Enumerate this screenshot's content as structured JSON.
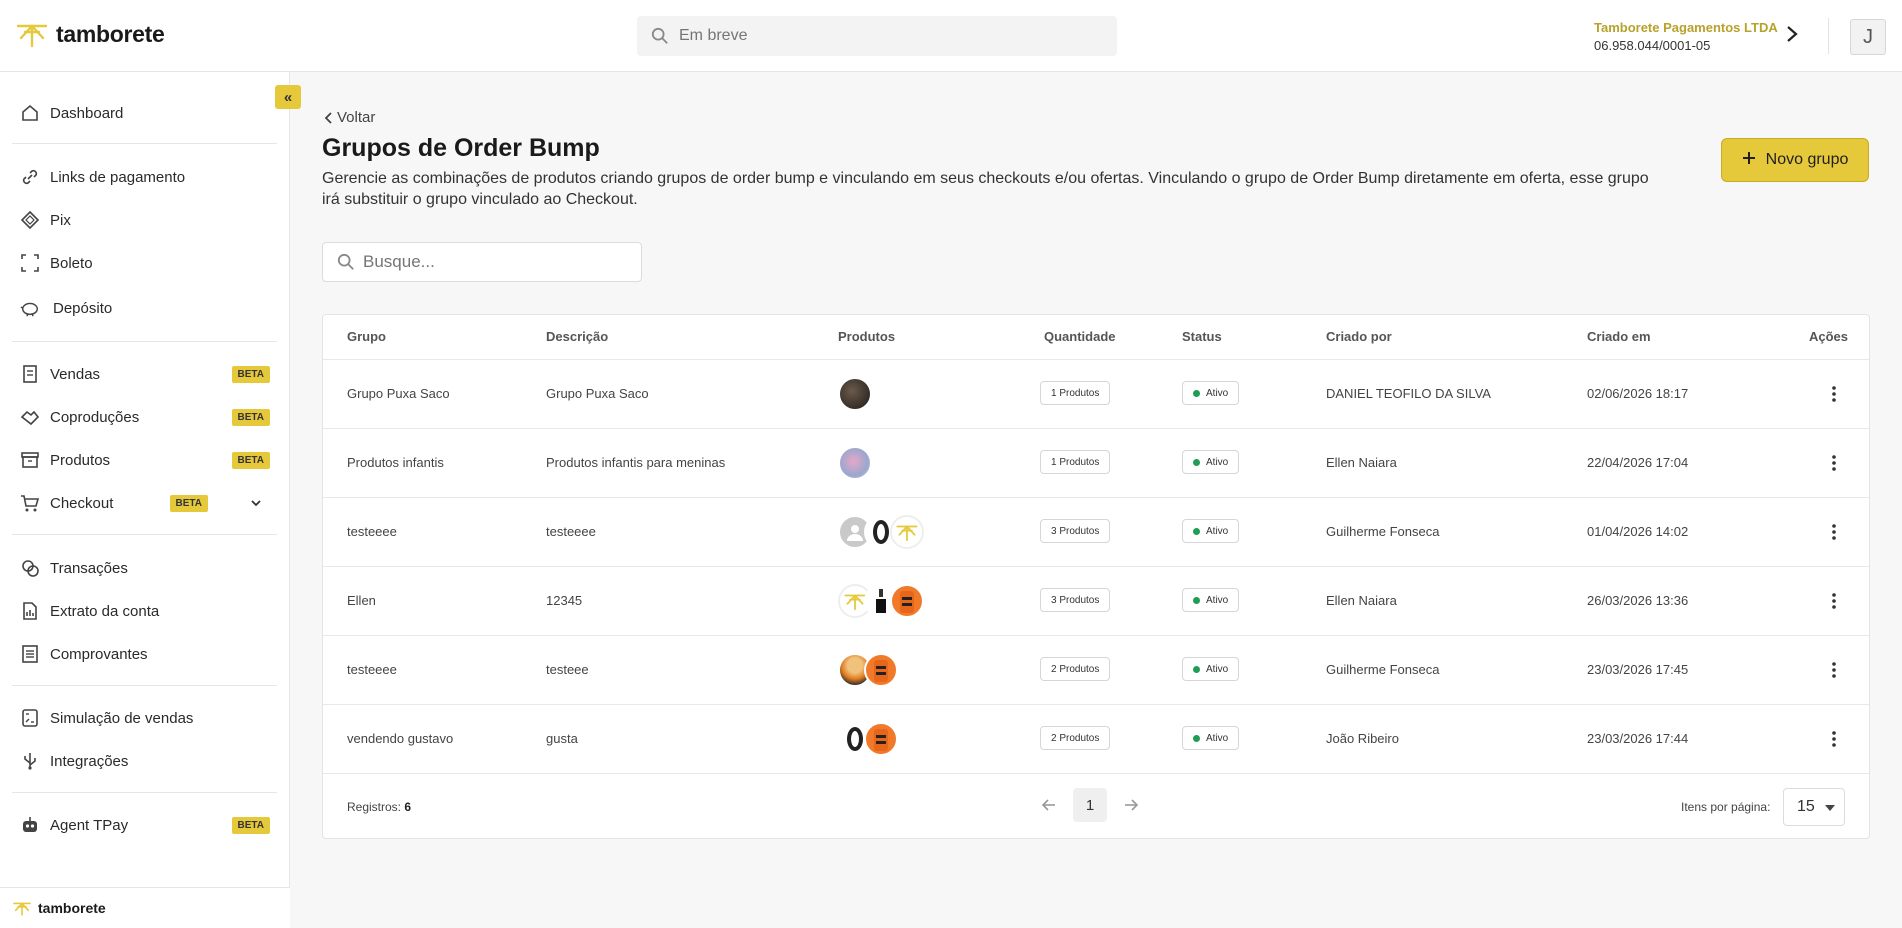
{
  "brand": {
    "name": "tamborete",
    "accent": "#e6c93a"
  },
  "search": {
    "placeholder": "Em breve"
  },
  "company": {
    "name": "Tamborete Pagamentos LTDA",
    "document": "06.958.044/0001-05"
  },
  "user": {
    "initial": "J"
  },
  "sidebar": {
    "collapse_label": "«",
    "items": [
      {
        "label": "Dashboard",
        "icon": "home-icon"
      },
      {
        "label": "Links de pagamento",
        "icon": "link-icon"
      },
      {
        "label": "Pix",
        "icon": "pix-icon"
      },
      {
        "label": "Boleto",
        "icon": "barcode-icon"
      },
      {
        "label": "Depósito",
        "icon": "piggy-bank-icon"
      },
      {
        "label": "Vendas",
        "icon": "receipt-icon",
        "badge": "BETA"
      },
      {
        "label": "Coproduções",
        "icon": "handshake-icon",
        "badge": "BETA"
      },
      {
        "label": "Produtos",
        "icon": "archive-icon",
        "badge": "BETA"
      },
      {
        "label": "Checkout",
        "icon": "cart-icon",
        "badge": "BETA"
      },
      {
        "label": "Transações",
        "icon": "coins-icon"
      },
      {
        "label": "Extrato da conta",
        "icon": "statement-icon"
      },
      {
        "label": "Comprovantes",
        "icon": "document-icon"
      },
      {
        "label": "Simulação de vendas",
        "icon": "calculator-icon"
      },
      {
        "label": "Integrações",
        "icon": "usb-icon"
      },
      {
        "label": "Agent TPay",
        "icon": "robot-icon",
        "badge": "BETA"
      }
    ],
    "footer_brand": "tamborete"
  },
  "page": {
    "back_label": "Voltar",
    "title": "Grupos de Order Bump",
    "description": "Gerencie as combinações de produtos criando grupos de order bump e vinculando em seus checkouts e/ou ofertas. Vinculando o grupo de Order Bump diretamente em oferta, esse grupo irá substituir o grupo vinculado ao Checkout.",
    "new_button": "Novo grupo",
    "search_placeholder": "Busque..."
  },
  "table": {
    "headers": [
      "Grupo",
      "Descrição",
      "Produtos",
      "Quantidade",
      "Status",
      "Criado por",
      "Criado em",
      "Ações"
    ],
    "rows": [
      {
        "grupo": "Grupo Puxa Saco",
        "descricao": "Grupo Puxa Saco",
        "produtos": [
          "photo-dark"
        ],
        "quantidade": "1 Produtos",
        "status": "Ativo",
        "criado_por": "DANIEL TEOFILO DA SILVA",
        "criado_em": "02/06/2026 18:17"
      },
      {
        "grupo": "Produtos infantis",
        "descricao": "Produtos infantis para meninas",
        "produtos": [
          "photo-pastel"
        ],
        "quantidade": "1 Produtos",
        "status": "Ativo",
        "criado_por": "Ellen Naiara",
        "criado_em": "22/04/2026 17:04"
      },
      {
        "grupo": "testeeee",
        "descricao": "testeeee",
        "produtos": [
          "placeholder-user",
          "tire",
          "logo"
        ],
        "quantidade": "3 Produtos",
        "status": "Ativo",
        "criado_por": "Guilherme Fonseca",
        "criado_em": "01/04/2026 14:02"
      },
      {
        "grupo": "Ellen",
        "descricao": "12345",
        "produtos": [
          "logo",
          "bottle",
          "orange-can"
        ],
        "quantidade": "3 Produtos",
        "status": "Ativo",
        "criado_por": "Ellen Naiara",
        "criado_em": "26/03/2026 13:36"
      },
      {
        "grupo": "testeeee",
        "descricao": "testeee",
        "produtos": [
          "anime-face",
          "orange-can"
        ],
        "quantidade": "2 Produtos",
        "status": "Ativo",
        "criado_por": "Guilherme Fonseca",
        "criado_em": "23/03/2026 17:45"
      },
      {
        "grupo": "vendendo gustavo",
        "descricao": "gusta",
        "produtos": [
          "tire",
          "orange-can"
        ],
        "quantidade": "2 Produtos",
        "status": "Ativo",
        "criado_por": "João Ribeiro",
        "criado_em": "23/03/2026 17:44"
      }
    ],
    "status_color": "#1f9d55"
  },
  "pagination": {
    "records_label": "Registros:",
    "records_count": "6",
    "current_page": "1",
    "per_page_label": "Itens por página:",
    "per_page_value": "15"
  }
}
